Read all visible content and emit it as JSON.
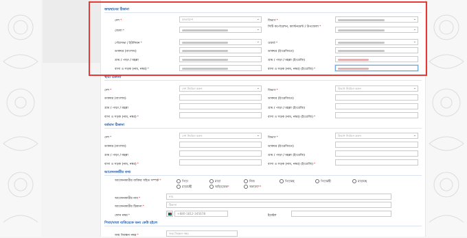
{
  "sections": {
    "permanent": "স্থায়ী ঠিকানা",
    "present": "বর্তমান ঠিকানা",
    "applicant": "আবেদনকারীর তথ্য",
    "other_applicant": "পিতা/মাতা ব্যতিরেকে অন্য কেউ হইলে"
  },
  "labels": {
    "country": "দেশ",
    "division": "বিভাগ",
    "district": "জেলা",
    "city_corp": "সিটি কর্পোরেশন, ক্যান্টনমেন্ট / উপজেলা",
    "pourashava": "পৌরসভা / ইউনিয়ন",
    "ward": "ওয়ার্ড",
    "po_bn": "ডাকঘর (বাংলায়)",
    "po_en": "ডাকঘর (ইংরেজিতে)",
    "village_bn": "গ্রাম / পাড়া / মহল্লা",
    "village_en": "গ্রাম / পাড়া / মহল্লা (ইংরেজি)",
    "house_bn": "বাসা ও সড়ক (নাম, নম্বর)",
    "house_en": "বাসা ও সড়ক (নাম, নম্বর) (ইংরেজি)",
    "relation": "আবেদনকারীর ব্যক্তির সহিত সম্পর্ক",
    "applicant_name": "আবেদনকারীর নাম",
    "applicant_address": "আবেদনকারীর ঠিকানা",
    "phone": "ফোন নম্বর",
    "email": "ইমেইল",
    "birth_reg_no": "জন্ম নিবন্ধন নম্বর",
    "req": "*"
  },
  "values": {
    "country_selected": "বাংলাদেশ",
    "select_country": "দেশ নির্বাচন করুন",
    "select_division": "বিভাগ নির্বাচন করুন"
  },
  "relations": [
    "পিতা",
    "মাতা",
    "নিজ",
    "পিতামহ",
    "পিতামহী",
    "মাতামহ",
    "মাতামহী",
    "অভিভাবক",
    "অন্যান্য"
  ],
  "placeholders": {
    "name": "নাম",
    "address": "ঠিকানা",
    "phone": "+880-1812-345678",
    "birth_reg": "জন্ম নিবন্ধন নম্বর"
  }
}
